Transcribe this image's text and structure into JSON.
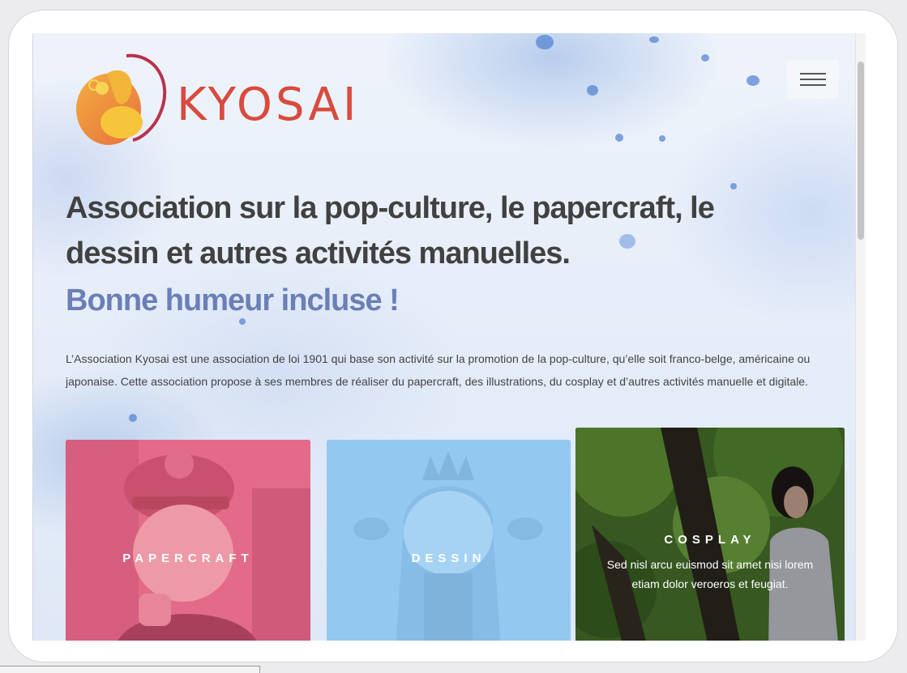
{
  "site": {
    "brand": "KYOSAI",
    "headline": "Association sur la pop-culture, le papercraft, le dessin et autres activités manuelles.",
    "tagline": "Bonne humeur incluse !",
    "intro": "L’Association Kyosai est une association de loi 1901 qui base son activité sur la promotion de la pop-culture, qu’elle soit franco-belge, américaine ou japonaise. Cette association propose à ses membres de réaliser du papercraft, des illustrations, du cosplay et d’autres activités manuelle et digitale."
  },
  "header": {
    "menu_icon": "hamburger-icon"
  },
  "cards": [
    {
      "title": "PAPERCRAFT",
      "overlay_color": "#e0678a"
    },
    {
      "title": "DESSIN",
      "overlay_color": "#8cc4ee"
    },
    {
      "title": "COSPLAY",
      "description": "Sed nisl arcu euismod sit amet nisi lorem etiam dolor veroeros et feugiat."
    }
  ],
  "colors": {
    "brand_red": "#d84b3e",
    "headline": "#414141",
    "tagline": "#6a7fb6"
  }
}
